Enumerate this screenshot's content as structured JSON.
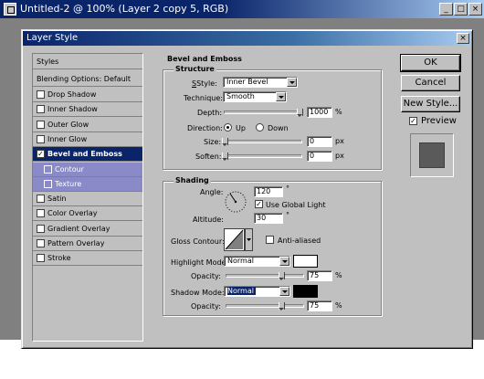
{
  "window": {
    "title": "Untitled-2 @ 100% (Layer 2 copy 5, RGB)",
    "min": "_",
    "max": "□",
    "close": "×"
  },
  "dialog": {
    "title": "Layer Style",
    "close": "×"
  },
  "stylelist": {
    "header": "Styles",
    "blending": "Blending Options: Default",
    "items": [
      {
        "label": "Drop Shadow",
        "checked": false
      },
      {
        "label": "Inner Shadow",
        "checked": false
      },
      {
        "label": "Outer Glow",
        "checked": false
      },
      {
        "label": "Inner Glow",
        "checked": false
      },
      {
        "label": "Bevel and Emboss",
        "checked": true
      },
      {
        "label": "Contour",
        "checked": false
      },
      {
        "label": "Texture",
        "checked": false
      },
      {
        "label": "Satin",
        "checked": false
      },
      {
        "label": "Color Overlay",
        "checked": false
      },
      {
        "label": "Gradient Overlay",
        "checked": false
      },
      {
        "label": "Pattern Overlay",
        "checked": false
      },
      {
        "label": "Stroke",
        "checked": false
      }
    ]
  },
  "bevel": {
    "title": "Bevel and Emboss",
    "structure_title": "Structure",
    "style_label": "Style:",
    "style_value": "Inner Bevel",
    "technique_label": "Technique:",
    "technique_value": "Smooth",
    "depth_label": "Depth:",
    "depth_value": "1000",
    "depth_unit": "%",
    "depth_level": 1.0,
    "direction_label": "Direction:",
    "direction_up": "Up",
    "direction_down": "Down",
    "size_label": "Size:",
    "size_value": "0",
    "size_unit": "px",
    "soften_label": "Soften:",
    "soften_value": "0",
    "soften_unit": "px"
  },
  "shading": {
    "title": "Shading",
    "angle_label": "Angle:",
    "angle_value": "120",
    "angle_unit": "°",
    "global_light_label": "Use Global Light",
    "global_light_checked": true,
    "altitude_label": "Altitude:",
    "altitude_value": "30",
    "altitude_unit": "°",
    "gloss_label": "Gloss Contour:",
    "anti_aliased_label": "Anti-aliased",
    "highlight_label": "Highlight Mode:",
    "highlight_value": "Normal",
    "highlight_color": "#ffffff",
    "hl_opacity_label": "Opacity:",
    "hl_opacity_value": "75",
    "hl_opacity_unit": "%",
    "shadow_label": "Shadow Mode:",
    "shadow_value": "Normal",
    "shadow_color": "#000000",
    "sh_opacity_label": "Opacity:",
    "sh_opacity_value": "75",
    "sh_opacity_unit": "%"
  },
  "buttons": {
    "ok": "OK",
    "cancel": "Cancel",
    "new_style": "New Style...",
    "preview": "Preview",
    "preview_checked": true
  },
  "colors": {
    "selection": "#0a246a",
    "sub_item": "#8a8ac8",
    "preview_swatch": "#5a5a5a"
  }
}
